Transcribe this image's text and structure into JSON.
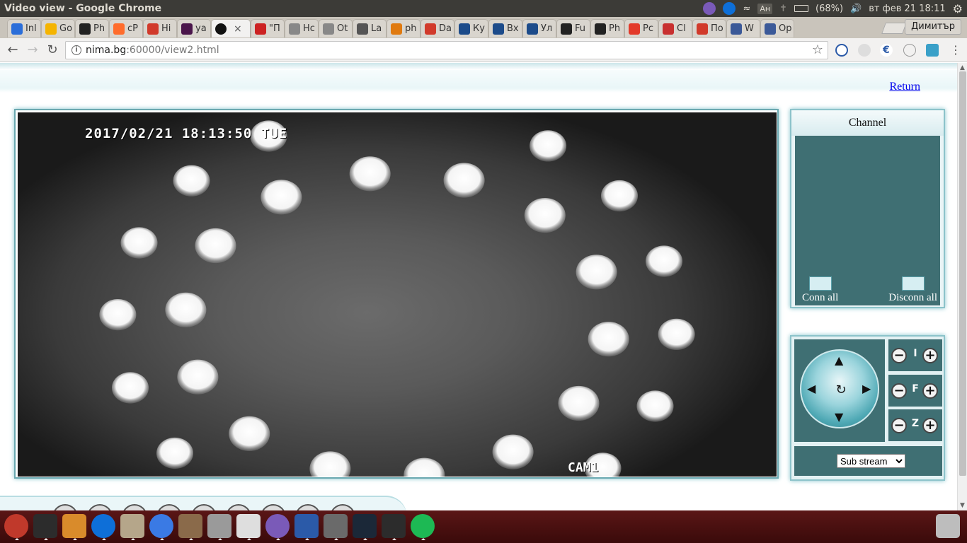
{
  "window": {
    "title": "Video view - Google Chrome",
    "battery": "(68%)",
    "datetime": "вт фев 21 18:11",
    "keyboard_indicator": "Ан"
  },
  "tabs": [
    {
      "label": "Inl",
      "icon": "gmail-icon",
      "color": "#2b6ed9"
    },
    {
      "label": "Go",
      "icon": "keep-icon",
      "color": "#f5b400"
    },
    {
      "label": "Ph",
      "icon": "github-icon",
      "color": "#222222"
    },
    {
      "label": "cP",
      "icon": "cpanel-icon",
      "color": "#ff6c2c"
    },
    {
      "label": "Hi",
      "icon": "hi-icon",
      "color": "#d13a2b"
    },
    {
      "label": "ya",
      "icon": "slack-icon",
      "color": "#4a154b"
    },
    {
      "label": "",
      "icon": "record-icon",
      "color": "#111111"
    },
    {
      "label": "\"П",
      "icon": "pin-icon",
      "color": "#cc2222"
    },
    {
      "label": "Нс",
      "icon": "page-icon",
      "color": "#888888"
    },
    {
      "label": "Ot",
      "icon": "page-icon",
      "color": "#888888"
    },
    {
      "label": "La",
      "icon": "send-icon",
      "color": "#555555"
    },
    {
      "label": "ph",
      "icon": "phpmyadmin-icon",
      "color": "#e07a10"
    },
    {
      "label": "Da",
      "icon": "stack-icon",
      "color": "#d13a2b"
    },
    {
      "label": "Ку",
      "icon": "house-icon",
      "color": "#1c4b8a"
    },
    {
      "label": "Вх",
      "icon": "house-icon",
      "color": "#1c4b8a"
    },
    {
      "label": "Ул",
      "icon": "house-icon",
      "color": "#1c4b8a"
    },
    {
      "label": "Fu",
      "icon": "film-icon",
      "color": "#222222"
    },
    {
      "label": "Ph",
      "icon": "github-icon",
      "color": "#222222"
    },
    {
      "label": "Pc",
      "icon": "opera-icon",
      "color": "#e33a2a"
    },
    {
      "label": "Cl",
      "icon": "cloud-icon",
      "color": "#c83030"
    },
    {
      "label": "По",
      "icon": "box-icon",
      "color": "#d13a2b"
    },
    {
      "label": "W",
      "icon": "facebook-icon",
      "color": "#3b5998"
    },
    {
      "label": "Op",
      "icon": "facebook-icon",
      "color": "#3b5998"
    }
  ],
  "profile_name": "Димитър",
  "url": {
    "host": "nima.bg",
    "rest": ":60000/view2.html"
  },
  "page": {
    "return_label": "Return",
    "osd_timestamp": "2017/02/21 18:13:50 TUE",
    "osd_camera": "CAM1",
    "channel_title": "Channel",
    "conn_all": "Conn all",
    "disconn_all": "Disconn all",
    "iris_label": "I",
    "focus_label": "F",
    "zoom_label": "Z",
    "stream_selected": "Sub stream"
  },
  "dock_apps": [
    {
      "name": "ubuntu-dash",
      "color": "#c0392b"
    },
    {
      "name": "terminal",
      "color": "#2c2c2c"
    },
    {
      "name": "sublime-text",
      "color": "#d98b2b"
    },
    {
      "name": "teamviewer",
      "color": "#0e6fd8"
    },
    {
      "name": "image-viewer",
      "color": "#b5a68a"
    },
    {
      "name": "chrome",
      "color": "#3a7ae4"
    },
    {
      "name": "file-manager",
      "color": "#8a6a4a"
    },
    {
      "name": "disk-tool",
      "color": "#9a9a9a"
    },
    {
      "name": "text-editor",
      "color": "#dedede"
    },
    {
      "name": "viber",
      "color": "#7a5ab8"
    },
    {
      "name": "writer",
      "color": "#2b5aa8"
    },
    {
      "name": "calculator",
      "color": "#6a6a6a"
    },
    {
      "name": "steam",
      "color": "#1b2838"
    },
    {
      "name": "system-monitor",
      "color": "#2c2c2c"
    },
    {
      "name": "spotify",
      "color": "#1db954"
    }
  ]
}
